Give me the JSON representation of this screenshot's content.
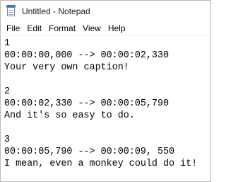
{
  "window": {
    "title": "Untitled - Notepad"
  },
  "menu": {
    "items": [
      "File",
      "Edit",
      "Format",
      "View",
      "Help"
    ]
  },
  "editor": {
    "lines": [
      "1",
      "00:00:00,000 --> 00:00:02,330",
      "Your very own caption!",
      "",
      "2",
      "00:00:02,330 --> 00:00:05,790",
      "And it's so easy to do.",
      "",
      "3",
      "00:00:05,790 --> 00:00:09, 550",
      "I mean, even a monkey could do it!"
    ]
  }
}
